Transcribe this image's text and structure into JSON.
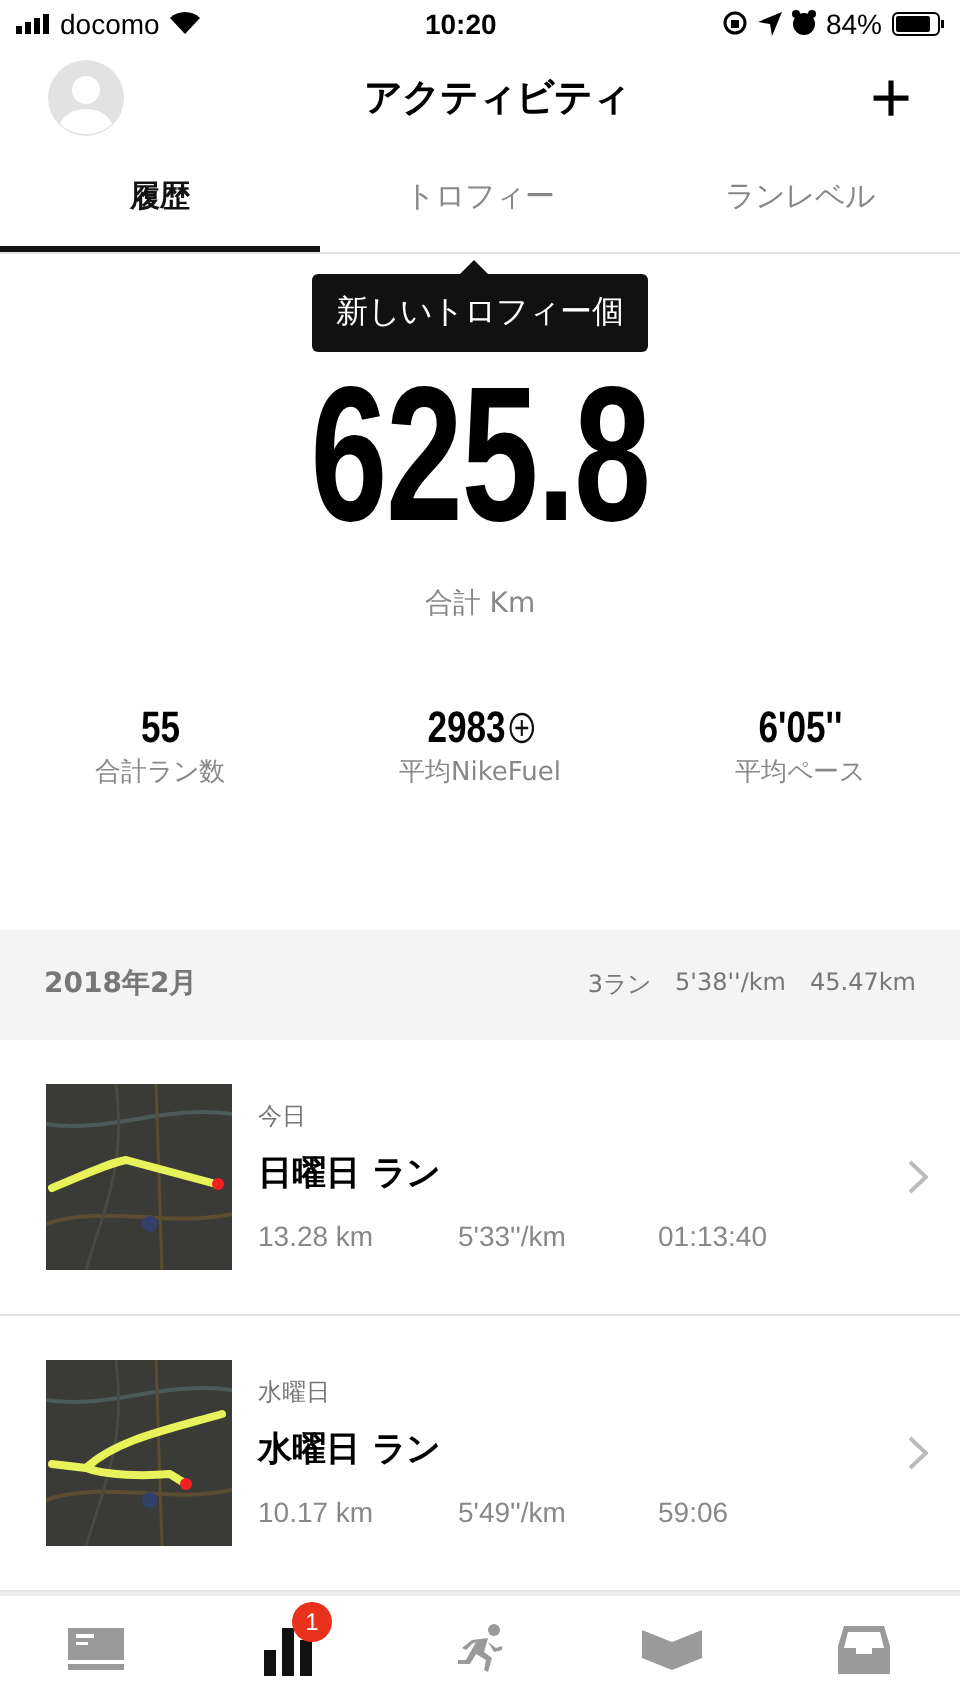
{
  "status_bar": {
    "carrier": "docomo",
    "time": "10:20",
    "battery": "84%"
  },
  "header": {
    "title": "アクティビティ",
    "add": "+"
  },
  "tabs": [
    {
      "label": "履歴",
      "selected": true
    },
    {
      "label": "トロフィー",
      "selected": false
    },
    {
      "label": "ランレベル",
      "selected": false
    }
  ],
  "tooltip": "新しいトロフィー個",
  "total": {
    "value": "625.8",
    "unit": "合計 Km"
  },
  "stats": [
    {
      "value": "55",
      "label": "合計ラン数",
      "kind": "plain"
    },
    {
      "value": "2983",
      "label": "平均NikeFuel",
      "kind": "fuel"
    },
    {
      "value": "6'05''",
      "label": "平均ペース",
      "kind": "plain"
    }
  ],
  "month": {
    "title": "2018年2月",
    "runs": "3ラン",
    "pace": "5'38''/km",
    "distance": "45.47km"
  },
  "runs": [
    {
      "day": "今日",
      "title": "日曜日 ラン",
      "distance": "13.28 km",
      "pace": "5'33''/km",
      "time": "01:13:40"
    },
    {
      "day": "水曜日",
      "title": "水曜日 ラン",
      "distance": "10.17 km",
      "pace": "5'49''/km",
      "time": "59:06"
    }
  ],
  "nav": [
    {
      "kind": "feed",
      "selected": false
    },
    {
      "kind": "activity",
      "selected": true,
      "badge": "1"
    },
    {
      "kind": "run",
      "selected": false
    },
    {
      "kind": "club",
      "selected": false
    },
    {
      "kind": "inbox",
      "selected": false
    }
  ]
}
